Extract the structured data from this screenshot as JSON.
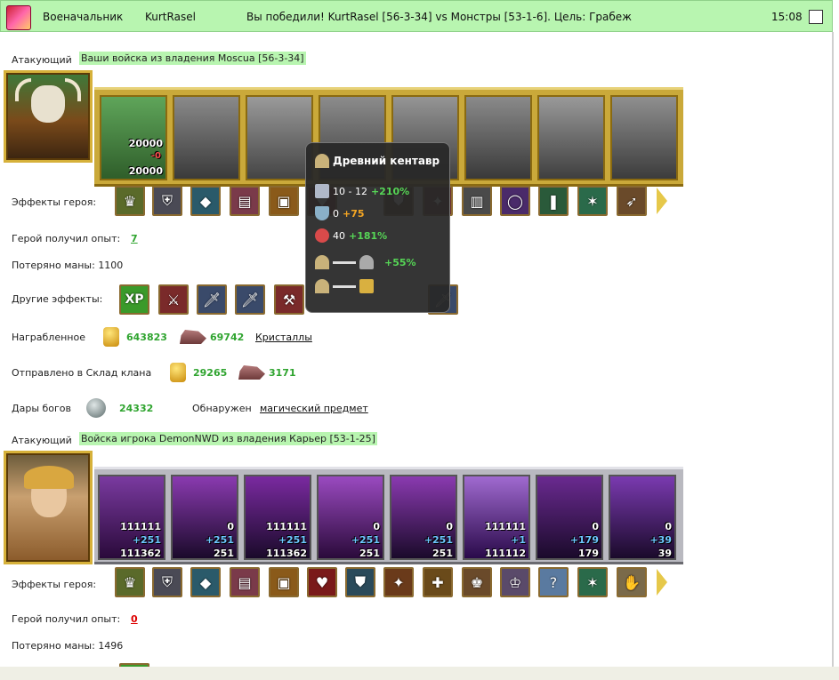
{
  "topbar": {
    "rank": "Военачальник",
    "player": "KurtRasel",
    "message": "Вы победили! KurtRasel [56-3-34] vs Монстры [53-1-6]. Цель: Грабеж",
    "time": "15:08"
  },
  "attacker1": {
    "label": "Атакующий",
    "army_title": "Ваши войска из владения Moscua [56-3-34]",
    "first_slot": {
      "count_top": "20000",
      "count_delta": "-0",
      "count_bottom": "20000"
    },
    "effects_label": "Эффекты героя:",
    "exp_label": "Герой получил опыт:",
    "exp_value": "7",
    "mana_label": "Потеряно маны: 1100",
    "other_effects_label": "Другие эффекты:",
    "xp_badge": "XP",
    "reward_label": "Награбленное",
    "reward_gold": "643823",
    "reward_crystals": "69742",
    "reward_link": "Кристаллы",
    "clan_label": "Отправлено в Склад клана",
    "clan_gold": "29265",
    "clan_crystals": "3171",
    "gifts_label": "Дары богов",
    "gifts_value": "24332",
    "found_label": "Обнаружен",
    "found_link": "магический предмет"
  },
  "tooltip": {
    "title": "Древний кентавр",
    "attack": "10 - 12",
    "attack_bonus": "+210%",
    "defense": "0",
    "defense_bonus": "+75",
    "hp": "40",
    "hp_bonus": "+181%",
    "vs_bonus": "+55%"
  },
  "attacker2": {
    "label": "Атакующий",
    "army_title": "Войска игрока DemonNWD из владения Карьер [53-1-25]",
    "slots": [
      {
        "a": "111111",
        "b": "+251",
        "c": "111362"
      },
      {
        "a": "0",
        "b": "+251",
        "c": "251"
      },
      {
        "a": "111111",
        "b": "+251",
        "c": "111362"
      },
      {
        "a": "0",
        "b": "+251",
        "c": "251"
      },
      {
        "a": "0",
        "b": "+251",
        "c": "251"
      },
      {
        "a": "111111",
        "b": "+1",
        "c": "111112"
      },
      {
        "a": "0",
        "b": "+179",
        "c": "179"
      },
      {
        "a": "0",
        "b": "+39",
        "c": "39"
      }
    ],
    "effects_label": "Эффекты героя:",
    "exp_label": "Герой получил опыт:",
    "exp_value": "0",
    "mana_label": "Потеряно маны: 1496"
  },
  "colors": {
    "topbar_bg": "#b8f5b0",
    "highlight": "#b8f5b0",
    "gain": "#2fa42f",
    "loss": "#dd0000"
  }
}
